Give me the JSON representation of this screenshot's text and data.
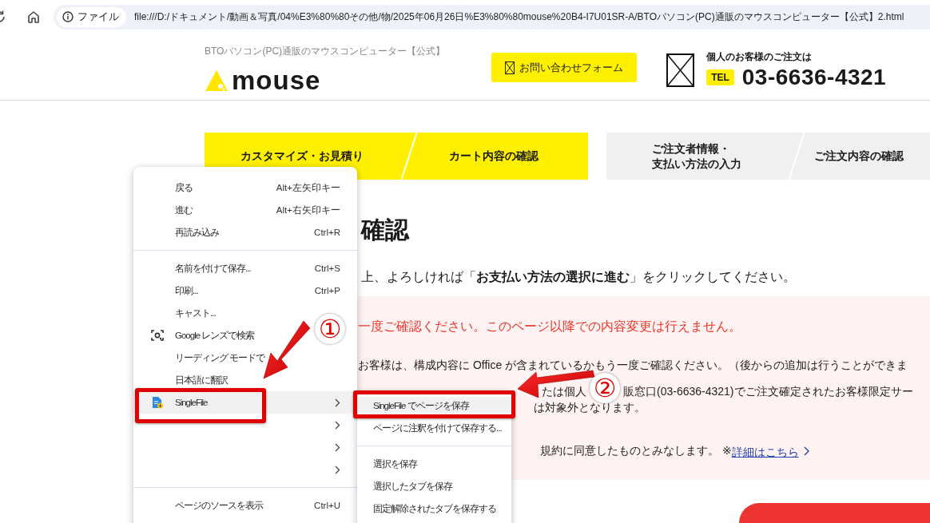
{
  "browser": {
    "info_label": "ファイル",
    "url": "file:///D:/ドキュメント/動画＆写真/04%E3%80%80その他/物/2025年06月26日%E3%80%80mouse%20B4-I7U01SR-A/BTOパソコン(PC)通販のマウスコンピューター【公式】2.html"
  },
  "header": {
    "tagline": "BTOパソコン(PC)通販のマウスコンピューター【公式】",
    "logo": "mouse",
    "contact_button": "お問い合わせフォーム",
    "order_note": "個人のお客様のご注文は",
    "tel_badge": "TEL",
    "phone": "03-6636-4321"
  },
  "steps": [
    {
      "label": "カスタマイズ・お見積り",
      "completed": true
    },
    {
      "label": "カート内容の確認",
      "completed": true
    },
    {
      "label": "ご注文者情報・",
      "label_line_2": "支払い方法の入力",
      "completed": false
    },
    {
      "label": "ご注文内容の確認",
      "completed": false
    }
  ],
  "content": {
    "heading": "確認",
    "intro": "上、よろしければ「**お支払い方法の選択に進む**」をクリックしてください。",
    "notice": {
      "warning": "一度ご確認ください。このページ以降での内容変更は行えません。",
      "office_note": "お客様は、構成内容に Office が含まれているかもう一度ご確認ください。（後からの追加は行うことができま",
      "phone_note_start": "たは個人",
      "phone_note_end": "販窓口(03-6636-4321)でご注文確定されたお客様限定サー",
      "exclusion_note": "は対象外となります。",
      "agreement": "規約に同意したものとみなします。 ※",
      "details_link": "詳細はこちら"
    }
  },
  "context_menu": {
    "items": [
      {
        "kind": "item",
        "label": "戻る",
        "shortcut": "Alt+左矢印キー"
      },
      {
        "kind": "item",
        "label": "進む",
        "shortcut": "Alt+右矢印キー"
      },
      {
        "kind": "item",
        "label": "再読み込み",
        "shortcut": "Ctrl+R"
      },
      {
        "kind": "separator"
      },
      {
        "kind": "item",
        "label": "名前を付けて保存...",
        "shortcut": "Ctrl+S"
      },
      {
        "kind": "item",
        "label": "印刷...",
        "shortcut": "Ctrl+P"
      },
      {
        "kind": "item",
        "label": "キャスト..."
      },
      {
        "kind": "lens",
        "label": "Google レンズで検索"
      },
      {
        "kind": "item",
        "label": "リーディング モードで"
      },
      {
        "kind": "item",
        "label": "日本語に翻訳"
      },
      {
        "kind": "extension",
        "label": "SingleFile",
        "submenu": true,
        "selected": true
      },
      {
        "kind": "item",
        "submenu": true,
        "selected": false
      },
      {
        "kind": "item",
        "submenu": true,
        "selected": false
      },
      {
        "kind": "item",
        "submenu": true,
        "selected": false
      },
      {
        "kind": "separator"
      },
      {
        "kind": "item",
        "label": "ページのソースを表示",
        "shortcut": "Ctrl+U"
      }
    ]
  },
  "submenu": {
    "items": [
      {
        "kind": "item",
        "label": "SingleFile でページを保存",
        "selected": true
      },
      {
        "kind": "item",
        "label": "ページに注釈を付けて保存する...",
        "selected": false
      },
      {
        "kind": "separator"
      },
      {
        "kind": "item",
        "label": "選択を保存",
        "selected": false
      },
      {
        "kind": "item",
        "label": "選択したタブを保存",
        "selected": false
      },
      {
        "kind": "item",
        "label": "固定解除されたタブを保存する",
        "selected": false
      }
    ]
  },
  "annotations": {
    "callouts": [
      {
        "number": "①"
      },
      {
        "number": "②"
      }
    ]
  }
}
